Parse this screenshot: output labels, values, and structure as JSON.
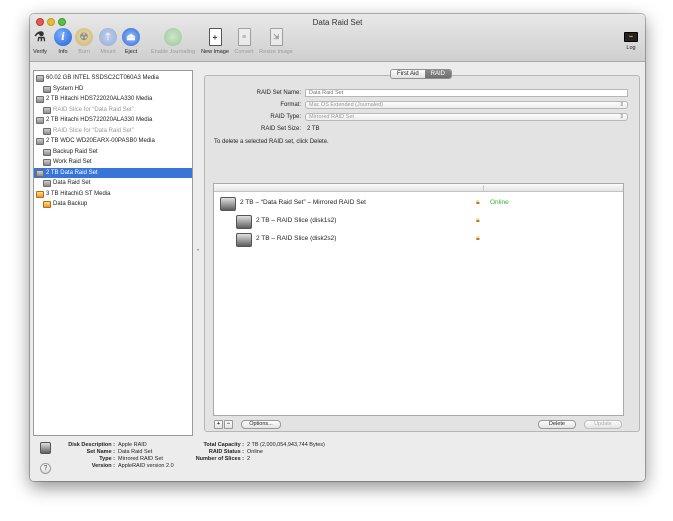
{
  "window": {
    "title": "Data Raid Set"
  },
  "toolbar": {
    "items": [
      {
        "label": "Verify",
        "icon": "microscope-icon",
        "enabled": true
      },
      {
        "label": "Info",
        "icon": "info-icon",
        "enabled": true
      },
      {
        "label": "Burn",
        "icon": "burn-icon",
        "enabled": false
      },
      {
        "label": "Mount",
        "icon": "mount-icon",
        "enabled": false
      },
      {
        "label": "Eject",
        "icon": "eject-icon",
        "enabled": true
      },
      {
        "label": "Enable Journaling",
        "icon": "journal-icon",
        "enabled": false
      },
      {
        "label": "New Image",
        "icon": "new-image-icon",
        "enabled": true
      },
      {
        "label": "Convert",
        "icon": "convert-icon",
        "enabled": false
      },
      {
        "label": "Resize Image",
        "icon": "resize-image-icon",
        "enabled": false
      }
    ],
    "log_label": "Log"
  },
  "sidebar": {
    "items": [
      {
        "label": "60.02 GB INTEL SSDSC2CT060A3 Media",
        "level": 0
      },
      {
        "label": "System HD",
        "level": 1
      },
      {
        "label": "2 TB Hitachi HDS722020ALA330 Media",
        "level": 0
      },
      {
        "label": "RAID Slice for “Data Raid Set”",
        "level": 1,
        "dim": true
      },
      {
        "label": "2 TB Hitachi HDS722020ALA330 Media",
        "level": 0
      },
      {
        "label": "RAID Slice for “Data Raid Set”",
        "level": 1,
        "dim": true
      },
      {
        "label": "2 TB WDC WD20EARX-00PASB0 Media",
        "level": 0
      },
      {
        "label": "Backup Raid Set",
        "level": 1
      },
      {
        "label": "Work Raid Set",
        "level": 1
      },
      {
        "label": "2 TB Data Raid Set",
        "level": 0,
        "selected": true
      },
      {
        "label": "Data Raid Set",
        "level": 1
      },
      {
        "label": "3 TB HitachiG ST Media",
        "level": 0,
        "orange": true
      },
      {
        "label": "Data Backup",
        "level": 1,
        "orange": true
      }
    ]
  },
  "tabs": {
    "first_aid": "First Aid",
    "raid": "RAID"
  },
  "raid_form": {
    "name_label": "RAID Set Name:",
    "name_placeholder": "Data Raid Set",
    "format_label": "Format:",
    "format_value": "Mac OS Extended (Journaled)",
    "type_label": "RAID Type:",
    "type_value": "Mirrored RAID Set",
    "size_label": "RAID Set Size:",
    "size_value": "2 TB",
    "note": "To delete a selected RAID set, click Delete."
  },
  "raid_list": {
    "set": {
      "label": "2 TB – “Data Raid Set” – Mirrored RAID Set",
      "status": "Online"
    },
    "slices": [
      {
        "label": "2 TB – RAID Slice (disk1s2)"
      },
      {
        "label": "2 TB – RAID Slice (disk2s2)"
      }
    ]
  },
  "buttons": {
    "add": "+",
    "remove": "−",
    "options": "Options...",
    "delete": "Delete",
    "update": "Update"
  },
  "info": {
    "description_label": "Disk Description :",
    "description_value": "Apple RAID",
    "set_name_label": "Set Name :",
    "set_name_value": "Data Raid Set",
    "type_label": "Type :",
    "type_value": "Mirrored RAID Set",
    "version_label": "Version :",
    "version_value": "AppleRAID version 2.0",
    "capacity_label": "Total Capacity :",
    "capacity_value": "2 TB (2,000,054,943,744 Bytes)",
    "status_label": "RAID Status :",
    "status_value": "Online",
    "slices_label": "Number of Slices :",
    "slices_value": "2"
  },
  "help_label": "?",
  "colors": {
    "selection": "#3875d7",
    "online": "#2db52d",
    "lock": "#c47d12"
  }
}
